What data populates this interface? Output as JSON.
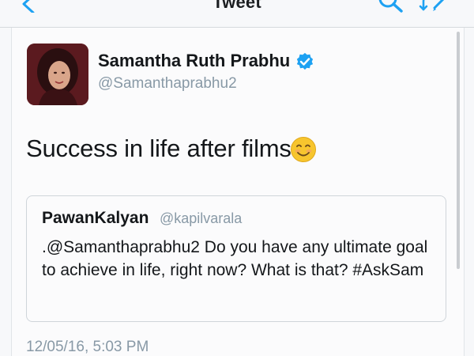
{
  "nav": {
    "title": "Tweet",
    "icons": {
      "back": "chevron-left-icon",
      "search": "search-icon",
      "compose": "compose-reply-icon"
    }
  },
  "tweet": {
    "author": {
      "display_name": "Samantha Ruth Prabhu",
      "username": "@Samanthaprabhu2",
      "verified": true,
      "avatar": "avatar-photo"
    },
    "text": "Success in life after films",
    "emoji": "smiling-face-icon",
    "timestamp": "12/05/16, 5:03 PM"
  },
  "quote": {
    "display_name": "PawanKalyan",
    "username": "@kapilvarala",
    "text": ".@Samanthaprabhu2 Do you have any ultimate goal to achieve in life, right now? What is that? #AskSam"
  },
  "colors": {
    "accent": "#1da1f2",
    "secondary_text": "#8899a6",
    "primary_text": "#14171a"
  }
}
